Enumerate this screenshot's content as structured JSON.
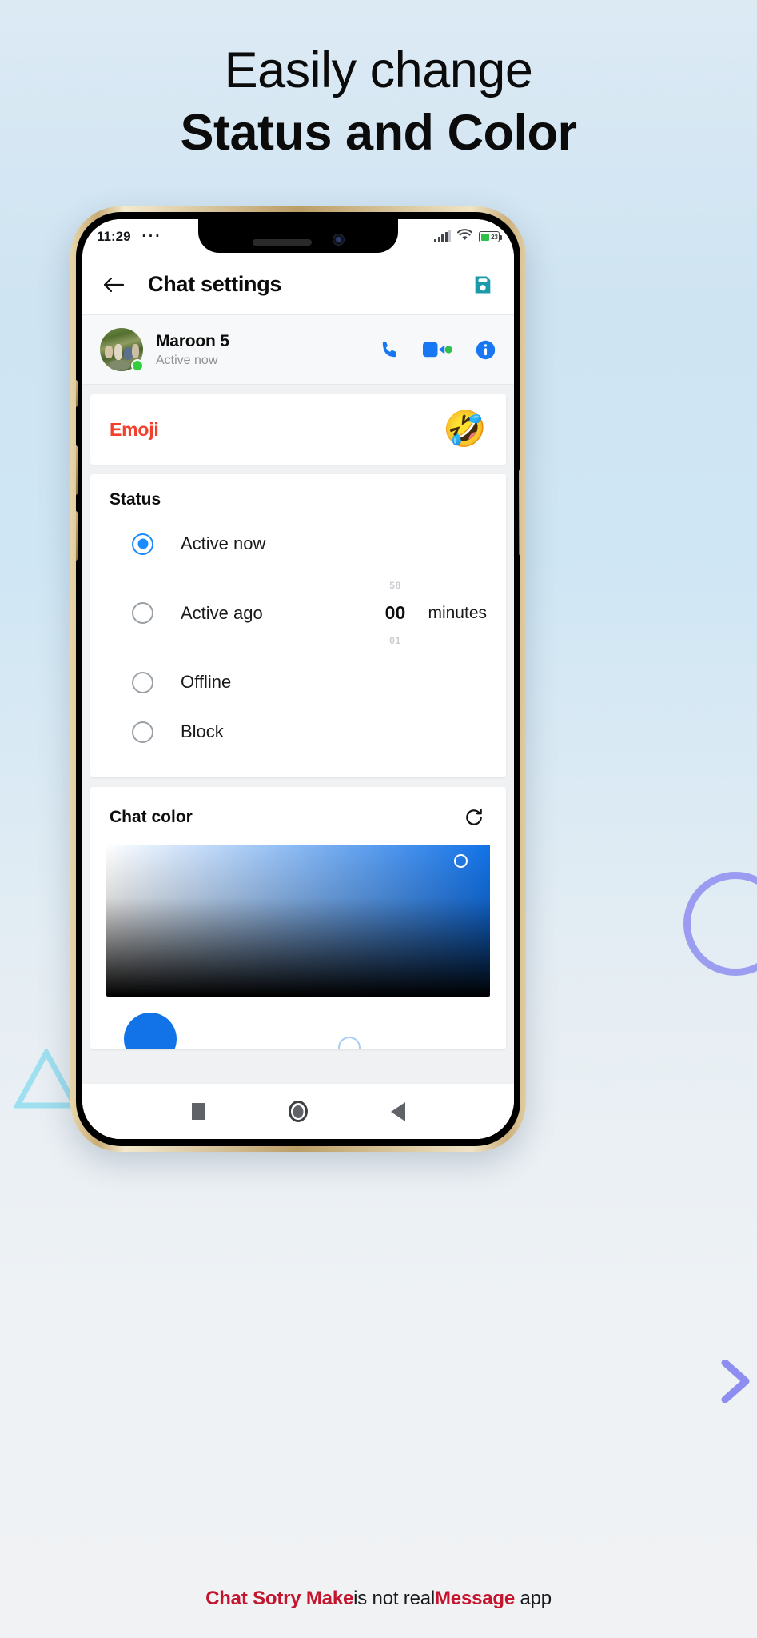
{
  "headline": {
    "line1": "Easily change",
    "line2": "Status and Color"
  },
  "phone": {
    "statusbar": {
      "time": "11:29",
      "dots": "···",
      "battery_level": "23"
    },
    "appbar": {
      "title": "Chat settings",
      "back_icon": "arrow-left-icon",
      "save_icon": "save-floppy-icon",
      "save_color": "#1a9aaa"
    },
    "contact": {
      "name": "Maroon 5",
      "status": "Active now",
      "online_color": "#31cf3c",
      "actions": [
        {
          "name": "call-button",
          "icon": "phone-icon",
          "color": "#1877f2"
        },
        {
          "name": "video-call-button",
          "icon": "video-camera-icon",
          "color": "#1877f2"
        },
        {
          "name": "info-button",
          "icon": "info-circle-icon",
          "color": "#1877f2"
        }
      ]
    },
    "emoji": {
      "label": "Emoji",
      "label_color": "#f2402c",
      "glyph": "🤣"
    },
    "status_section": {
      "title": "Status",
      "options": [
        {
          "label": "Active now",
          "selected": true
        },
        {
          "label": "Active ago",
          "selected": false
        },
        {
          "label": "Offline",
          "selected": false
        },
        {
          "label": "Block",
          "selected": false
        }
      ],
      "minutes_picker": {
        "prev": "58",
        "value": "00",
        "next": "01",
        "unit": "minutes"
      },
      "accent_color": "#1a8cff"
    },
    "chat_color": {
      "title": "Chat color",
      "refresh_icon": "refresh-icon",
      "selected_color": "#1272e8"
    },
    "navbar": {
      "recents_icon": "square-icon",
      "home_icon": "circle-icon",
      "back_icon": "triangle-back-icon"
    }
  },
  "footer": {
    "brand": "Chat Sotry Make",
    "middle": "is not real",
    "brand2": "Message",
    "tail": " app",
    "brand_color": "#c4152f"
  }
}
